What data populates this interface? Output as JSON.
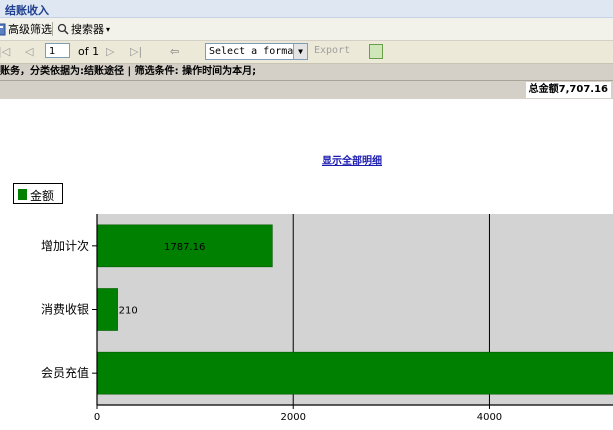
{
  "window": {
    "title": "结账收入"
  },
  "toolbar": {
    "advanced_filter_label": "高级筛选",
    "searcher_label": "搜索器",
    "searcher_arrow": "▾"
  },
  "report_toolbar": {
    "first_icon": "|◁",
    "prev_icon": "◁",
    "page_value": "1",
    "page_count": "of 1",
    "next_icon": "▷",
    "last_icon": "▷|",
    "back_icon": "⇦",
    "format_select": "Select a format",
    "export_label": "Export"
  },
  "criteria_text": "账务，分类依据为:结账途径  |  筛选条件: 操作时间为本月;",
  "total_text": "总金额7,707.16",
  "show_all_link": "显示全部明细",
  "legend_label": "金额",
  "colors": {
    "bar": "#008000",
    "plot_bg": "#d3d3d3"
  },
  "chart_data": {
    "type": "bar",
    "orientation": "horizontal",
    "categories": [
      "增加计次",
      "消费收银",
      "会员充值"
    ],
    "values": [
      1787.16,
      210,
      5710
    ],
    "data_labels": [
      "1787.16",
      "210",
      ""
    ],
    "x_ticks": [
      "0",
      "2000",
      "4000"
    ],
    "xlim": [
      0,
      5300
    ],
    "legend": [
      "金额"
    ],
    "grid": true
  }
}
